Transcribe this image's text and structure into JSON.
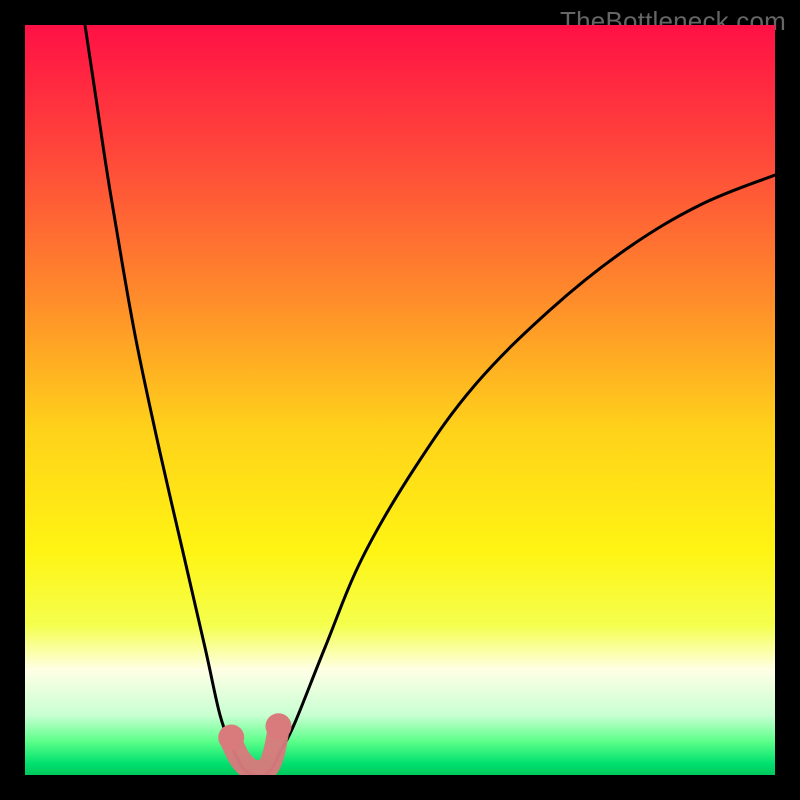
{
  "watermark": "TheBottleneck.com",
  "chart_data": {
    "type": "line",
    "title": "",
    "xlabel": "",
    "ylabel": "",
    "xlim": [
      0,
      100
    ],
    "ylim": [
      0,
      100
    ],
    "gradient_stops": [
      {
        "offset": 0.0,
        "color": "#ff1045"
      },
      {
        "offset": 0.18,
        "color": "#ff4a3a"
      },
      {
        "offset": 0.36,
        "color": "#ff8a2b"
      },
      {
        "offset": 0.54,
        "color": "#ffd21a"
      },
      {
        "offset": 0.7,
        "color": "#fff413"
      },
      {
        "offset": 0.8,
        "color": "#f4ff4d"
      },
      {
        "offset": 0.86,
        "color": "#ffffe6"
      },
      {
        "offset": 0.92,
        "color": "#c9ffd2"
      },
      {
        "offset": 0.955,
        "color": "#5dff8a"
      },
      {
        "offset": 0.985,
        "color": "#00e06e"
      },
      {
        "offset": 1.0,
        "color": "#00c95c"
      }
    ],
    "series": [
      {
        "name": "bottleneck-curve",
        "x": [
          8,
          9.5,
          11,
          13,
          15,
          18,
          21,
          24,
          26,
          27.5,
          29,
          30.5,
          32,
          33,
          34,
          36,
          40,
          45,
          52,
          60,
          70,
          80,
          90,
          100
        ],
        "values": [
          100,
          90,
          80,
          68,
          57,
          43,
          30,
          17,
          8,
          4,
          1,
          0,
          0,
          1,
          3,
          7,
          17,
          29,
          41,
          52,
          62,
          70,
          76,
          80
        ]
      }
    ],
    "highlight_segment": {
      "x": [
        27.5,
        28.5,
        29.5,
        30.5,
        31.5,
        32.5,
        33.2,
        33.8
      ],
      "values": [
        4.5,
        2.4,
        1.2,
        0.6,
        0.6,
        1.2,
        3.0,
        6.0
      ]
    },
    "highlight_dots": [
      {
        "x": 27.5,
        "y": 5.0
      },
      {
        "x": 33.8,
        "y": 6.5
      }
    ]
  }
}
